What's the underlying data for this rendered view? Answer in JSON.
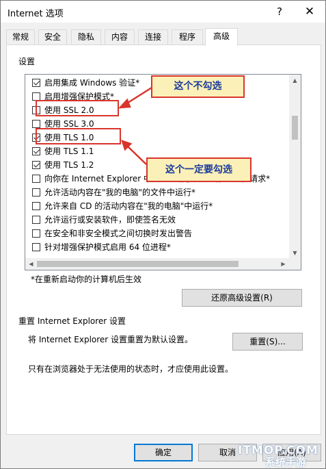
{
  "window": {
    "title": "Internet 选项",
    "help_label": "?",
    "close_label": "✕"
  },
  "tabs": [
    {
      "label": "常规"
    },
    {
      "label": "安全"
    },
    {
      "label": "隐私"
    },
    {
      "label": "内容"
    },
    {
      "label": "连接"
    },
    {
      "label": "程序"
    },
    {
      "label": "高级",
      "active": true
    }
  ],
  "settings": {
    "group_label": "设置",
    "items": [
      {
        "label": "启用集成 Windows 验证*",
        "checked": true
      },
      {
        "label": "启用增强保护模式*",
        "checked": false
      },
      {
        "label": "使用 SSL 2.0",
        "checked": false
      },
      {
        "label": "使用 SSL 3.0",
        "checked": false
      },
      {
        "label": "使用 TLS 1.0",
        "checked": true
      },
      {
        "label": "使用 TLS 1.1",
        "checked": true
      },
      {
        "label": "使用 TLS 1.2",
        "checked": true
      },
      {
        "label": "向你在 Internet Explorer 中发送的请求发送\"请勿跟踪\"请求*",
        "checked": false
      },
      {
        "label": "允许活动内容在\"我的电脑\"的文件中运行*",
        "checked": false
      },
      {
        "label": "允许来自 CD 的活动内容在\"我的电脑\"中运行*",
        "checked": false
      },
      {
        "label": "允许运行或安装软件，即使签名无效",
        "checked": false
      },
      {
        "label": "在安全和非安全模式之间切换时发出警告",
        "checked": false
      },
      {
        "label": "针对增强保护模式启用 64 位进程*",
        "checked": false
      }
    ],
    "restart_note": "*在重新启动你的计算机后生效",
    "restore_button": "还原高级设置(R)"
  },
  "reset": {
    "group_label": "重置 Internet Explorer 设置",
    "description": "将 Internet Explorer 设置重置为默认设置。",
    "reset_button": "重置(S)...",
    "note": "只有在浏览器处于无法使用的状态时，才应使用此设置。"
  },
  "buttons": {
    "ok": "确定",
    "cancel": "取消",
    "apply": "应用(A)"
  },
  "annotations": {
    "callout_1": "这个不勾选",
    "callout_2": "这个一定要勾选",
    "color": "#d9342b",
    "callout_bg": "#fbf0b8"
  },
  "watermark": {
    "line1": "ITMOP.COM",
    "line2": "系统手游"
  },
  "icons": {
    "scroll_up": "▲",
    "scroll_down": "▼",
    "scroll_left": "◀",
    "scroll_right": "▶"
  }
}
